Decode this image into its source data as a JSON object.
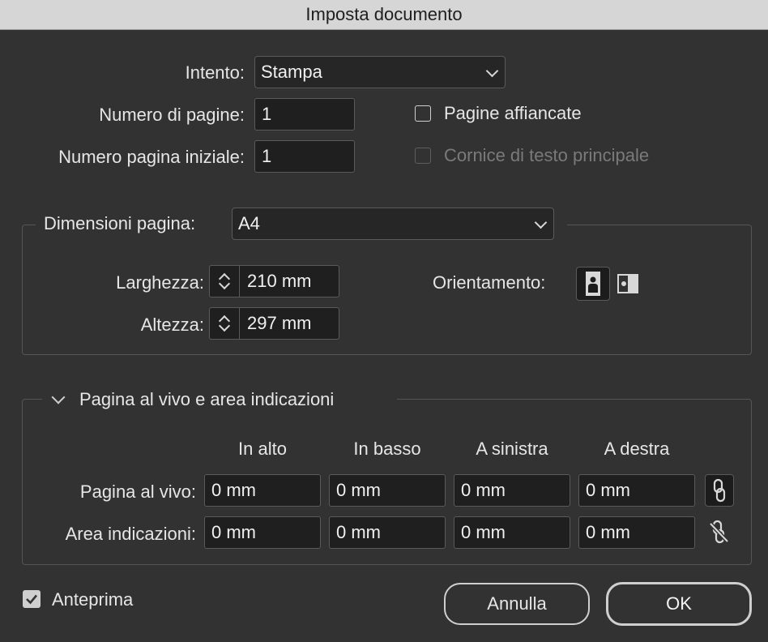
{
  "window": {
    "title": "Imposta documento"
  },
  "intent": {
    "label": "Intento:",
    "value": "Stampa"
  },
  "num_pages": {
    "label": "Numero di pagine:",
    "value": "1"
  },
  "start_page": {
    "label": "Numero pagina iniziale:",
    "value": "1"
  },
  "facing_pages": {
    "label": "Pagine affiancate",
    "checked": false
  },
  "primary_text_frame": {
    "label": "Cornice di testo principale",
    "checked": false,
    "enabled": false
  },
  "page_size": {
    "label": "Dimensioni pagina:",
    "value": "A4",
    "width_label": "Larghezza:",
    "width_value": "210 mm",
    "height_label": "Altezza:",
    "height_value": "297 mm",
    "orientation_label": "Orientamento:",
    "orientation_selected": "portrait"
  },
  "bleed_slug": {
    "title": "Pagina al vivo e area indicazioni",
    "expanded": true,
    "columns": [
      "In alto",
      "In basso",
      "A sinistra",
      "A destra"
    ],
    "rows": [
      {
        "label": "Pagina al vivo:",
        "values": [
          "0 mm",
          "0 mm",
          "0 mm",
          "0 mm"
        ],
        "linked": true
      },
      {
        "label": "Area indicazioni:",
        "values": [
          "0 mm",
          "0 mm",
          "0 mm",
          "0 mm"
        ],
        "linked": false
      }
    ]
  },
  "preview": {
    "label": "Anteprima",
    "checked": true
  },
  "buttons": {
    "cancel": "Annulla",
    "ok": "OK"
  },
  "icons": [
    "chevron-down-icon",
    "stepper-arrows-icon",
    "portrait-icon",
    "landscape-icon",
    "link-icon",
    "unlink-icon",
    "disclosure-chevron-icon",
    "checkmark-icon"
  ]
}
